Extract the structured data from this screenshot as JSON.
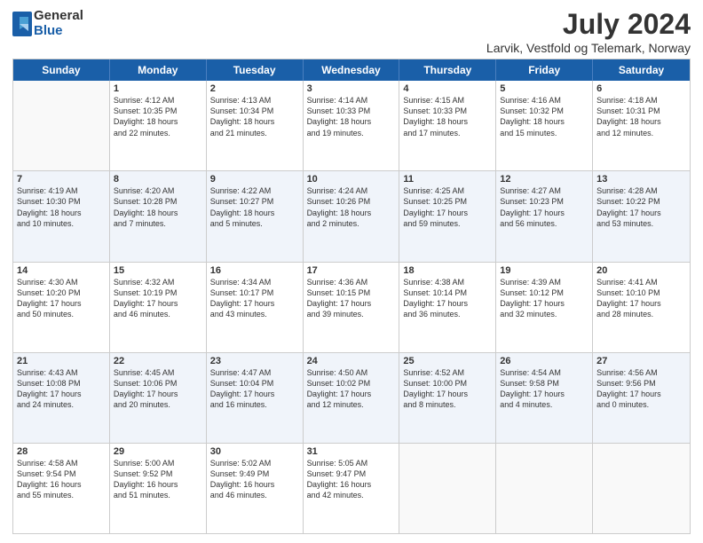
{
  "logo": {
    "general": "General",
    "blue": "Blue"
  },
  "title": "July 2024",
  "location": "Larvik, Vestfold og Telemark, Norway",
  "days": [
    "Sunday",
    "Monday",
    "Tuesday",
    "Wednesday",
    "Thursday",
    "Friday",
    "Saturday"
  ],
  "weeks": [
    [
      {
        "day": "",
        "content": ""
      },
      {
        "day": "1",
        "content": "Sunrise: 4:12 AM\nSunset: 10:35 PM\nDaylight: 18 hours\nand 22 minutes."
      },
      {
        "day": "2",
        "content": "Sunrise: 4:13 AM\nSunset: 10:34 PM\nDaylight: 18 hours\nand 21 minutes."
      },
      {
        "day": "3",
        "content": "Sunrise: 4:14 AM\nSunset: 10:33 PM\nDaylight: 18 hours\nand 19 minutes."
      },
      {
        "day": "4",
        "content": "Sunrise: 4:15 AM\nSunset: 10:33 PM\nDaylight: 18 hours\nand 17 minutes."
      },
      {
        "day": "5",
        "content": "Sunrise: 4:16 AM\nSunset: 10:32 PM\nDaylight: 18 hours\nand 15 minutes."
      },
      {
        "day": "6",
        "content": "Sunrise: 4:18 AM\nSunset: 10:31 PM\nDaylight: 18 hours\nand 12 minutes."
      }
    ],
    [
      {
        "day": "7",
        "content": "Sunrise: 4:19 AM\nSunset: 10:30 PM\nDaylight: 18 hours\nand 10 minutes."
      },
      {
        "day": "8",
        "content": "Sunrise: 4:20 AM\nSunset: 10:28 PM\nDaylight: 18 hours\nand 7 minutes."
      },
      {
        "day": "9",
        "content": "Sunrise: 4:22 AM\nSunset: 10:27 PM\nDaylight: 18 hours\nand 5 minutes."
      },
      {
        "day": "10",
        "content": "Sunrise: 4:24 AM\nSunset: 10:26 PM\nDaylight: 18 hours\nand 2 minutes."
      },
      {
        "day": "11",
        "content": "Sunrise: 4:25 AM\nSunset: 10:25 PM\nDaylight: 17 hours\nand 59 minutes."
      },
      {
        "day": "12",
        "content": "Sunrise: 4:27 AM\nSunset: 10:23 PM\nDaylight: 17 hours\nand 56 minutes."
      },
      {
        "day": "13",
        "content": "Sunrise: 4:28 AM\nSunset: 10:22 PM\nDaylight: 17 hours\nand 53 minutes."
      }
    ],
    [
      {
        "day": "14",
        "content": "Sunrise: 4:30 AM\nSunset: 10:20 PM\nDaylight: 17 hours\nand 50 minutes."
      },
      {
        "day": "15",
        "content": "Sunrise: 4:32 AM\nSunset: 10:19 PM\nDaylight: 17 hours\nand 46 minutes."
      },
      {
        "day": "16",
        "content": "Sunrise: 4:34 AM\nSunset: 10:17 PM\nDaylight: 17 hours\nand 43 minutes."
      },
      {
        "day": "17",
        "content": "Sunrise: 4:36 AM\nSunset: 10:15 PM\nDaylight: 17 hours\nand 39 minutes."
      },
      {
        "day": "18",
        "content": "Sunrise: 4:38 AM\nSunset: 10:14 PM\nDaylight: 17 hours\nand 36 minutes."
      },
      {
        "day": "19",
        "content": "Sunrise: 4:39 AM\nSunset: 10:12 PM\nDaylight: 17 hours\nand 32 minutes."
      },
      {
        "day": "20",
        "content": "Sunrise: 4:41 AM\nSunset: 10:10 PM\nDaylight: 17 hours\nand 28 minutes."
      }
    ],
    [
      {
        "day": "21",
        "content": "Sunrise: 4:43 AM\nSunset: 10:08 PM\nDaylight: 17 hours\nand 24 minutes."
      },
      {
        "day": "22",
        "content": "Sunrise: 4:45 AM\nSunset: 10:06 PM\nDaylight: 17 hours\nand 20 minutes."
      },
      {
        "day": "23",
        "content": "Sunrise: 4:47 AM\nSunset: 10:04 PM\nDaylight: 17 hours\nand 16 minutes."
      },
      {
        "day": "24",
        "content": "Sunrise: 4:50 AM\nSunset: 10:02 PM\nDaylight: 17 hours\nand 12 minutes."
      },
      {
        "day": "25",
        "content": "Sunrise: 4:52 AM\nSunset: 10:00 PM\nDaylight: 17 hours\nand 8 minutes."
      },
      {
        "day": "26",
        "content": "Sunrise: 4:54 AM\nSunset: 9:58 PM\nDaylight: 17 hours\nand 4 minutes."
      },
      {
        "day": "27",
        "content": "Sunrise: 4:56 AM\nSunset: 9:56 PM\nDaylight: 17 hours\nand 0 minutes."
      }
    ],
    [
      {
        "day": "28",
        "content": "Sunrise: 4:58 AM\nSunset: 9:54 PM\nDaylight: 16 hours\nand 55 minutes."
      },
      {
        "day": "29",
        "content": "Sunrise: 5:00 AM\nSunset: 9:52 PM\nDaylight: 16 hours\nand 51 minutes."
      },
      {
        "day": "30",
        "content": "Sunrise: 5:02 AM\nSunset: 9:49 PM\nDaylight: 16 hours\nand 46 minutes."
      },
      {
        "day": "31",
        "content": "Sunrise: 5:05 AM\nSunset: 9:47 PM\nDaylight: 16 hours\nand 42 minutes."
      },
      {
        "day": "",
        "content": ""
      },
      {
        "day": "",
        "content": ""
      },
      {
        "day": "",
        "content": ""
      }
    ]
  ]
}
